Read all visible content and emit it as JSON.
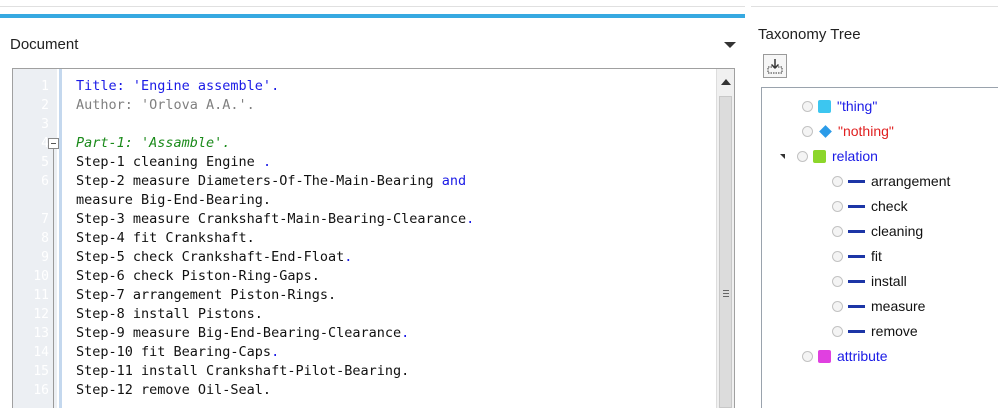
{
  "document": {
    "title": "Document",
    "line_numbers": [
      "1",
      "2",
      "3",
      "4",
      "5",
      "6",
      "7",
      "8",
      "9",
      "10",
      "11",
      "12",
      "13",
      "14",
      "15",
      "16"
    ],
    "lines": [
      {
        "num": "1",
        "parts": [
          {
            "t": "Title: 'Engine assemble'.",
            "c": "c-title"
          }
        ]
      },
      {
        "num": "2",
        "parts": [
          {
            "t": "Author: 'Orlova A.A.'.",
            "c": "c-author"
          }
        ]
      },
      {
        "num": "3",
        "parts": [
          {
            "t": "",
            "c": ""
          }
        ]
      },
      {
        "num": "4",
        "parts": [
          {
            "t": "Part-1: 'Assamble'.",
            "c": "c-part"
          }
        ]
      },
      {
        "num": "5",
        "parts": [
          {
            "t": "Step-1 cleaning Engine ",
            "c": ""
          },
          {
            "t": ".",
            "c": "c-punct"
          }
        ]
      },
      {
        "num": "6",
        "parts": [
          {
            "t": "Step-2 measure Diameters-Of-The-Main-Bearing ",
            "c": ""
          },
          {
            "t": "and",
            "c": "c-kw"
          }
        ]
      },
      {
        "num": "",
        "parts": [
          {
            "t": "measure Big-End-Bearing.",
            "c": ""
          }
        ]
      },
      {
        "num": "7",
        "parts": [
          {
            "t": "Step-3 measure Crankshaft-Main-Bearing-Clearance",
            "c": ""
          },
          {
            "t": ".",
            "c": "c-punct"
          }
        ]
      },
      {
        "num": "8",
        "parts": [
          {
            "t": "Step-4 fit Crankshaft.",
            "c": ""
          }
        ]
      },
      {
        "num": "9",
        "parts": [
          {
            "t": "Step-5 check Crankshaft-End-Float",
            "c": ""
          },
          {
            "t": ".",
            "c": "c-punct"
          }
        ]
      },
      {
        "num": "10",
        "parts": [
          {
            "t": "Step-6 check Piston-Ring-Gaps.",
            "c": ""
          }
        ]
      },
      {
        "num": "11",
        "parts": [
          {
            "t": "Step-7 arrangement Piston-Rings.",
            "c": ""
          }
        ]
      },
      {
        "num": "12",
        "parts": [
          {
            "t": "Step-8 install Pistons.",
            "c": ""
          }
        ]
      },
      {
        "num": "13",
        "parts": [
          {
            "t": "Step-9 measure Big-End-Bearing-Clearance",
            "c": ""
          },
          {
            "t": ".",
            "c": "c-punct"
          }
        ]
      },
      {
        "num": "14",
        "parts": [
          {
            "t": "Step-10 fit Bearing-Caps",
            "c": ""
          },
          {
            "t": ".",
            "c": "c-punct"
          }
        ]
      },
      {
        "num": "15",
        "parts": [
          {
            "t": "Step-11 install Crankshaft-Pilot-Bearing.",
            "c": ""
          }
        ]
      },
      {
        "num": "16",
        "parts": [
          {
            "t": "Step-12 remove Oil-Seal.",
            "c": ""
          }
        ]
      }
    ]
  },
  "taxonomy": {
    "title": "Taxonomy Tree",
    "nodes": [
      {
        "label": "\"thing\"",
        "color": "#1a1ae6",
        "marker": "cube",
        "marker_color": "#3cc6f0",
        "level": 0,
        "expander": false
      },
      {
        "label": "\"nothing\"",
        "color": "#e02020",
        "marker": "diamond",
        "marker_color": "#2b9be8",
        "level": 0,
        "expander": false
      },
      {
        "label": "relation",
        "color": "#1a1ae6",
        "marker": "cube",
        "marker_color": "#8cd62a",
        "level": 0,
        "expander": true
      },
      {
        "label": "arrangement",
        "color": "#111111",
        "marker": "dash",
        "marker_color": "#1c35a6",
        "level": 1,
        "expander": false
      },
      {
        "label": "check",
        "color": "#111111",
        "marker": "dash",
        "marker_color": "#1c35a6",
        "level": 1,
        "expander": false
      },
      {
        "label": "cleaning",
        "color": "#111111",
        "marker": "dash",
        "marker_color": "#1c35a6",
        "level": 1,
        "expander": false
      },
      {
        "label": "fit",
        "color": "#111111",
        "marker": "dash",
        "marker_color": "#1c35a6",
        "level": 1,
        "expander": false
      },
      {
        "label": "install",
        "color": "#111111",
        "marker": "dash",
        "marker_color": "#1c35a6",
        "level": 1,
        "expander": false
      },
      {
        "label": "measure",
        "color": "#111111",
        "marker": "dash",
        "marker_color": "#1c35a6",
        "level": 1,
        "expander": false
      },
      {
        "label": "remove",
        "color": "#111111",
        "marker": "dash",
        "marker_color": "#1c35a6",
        "level": 1,
        "expander": false
      },
      {
        "label": "attribute",
        "color": "#1a1ae6",
        "marker": "cube",
        "marker_color": "#e040e0",
        "level": 0,
        "expander": false
      }
    ]
  },
  "colors": {
    "accent": "#36a9e1",
    "keyword": "#1a1ae6",
    "comment": "#808080",
    "part": "#1a8a1a"
  }
}
